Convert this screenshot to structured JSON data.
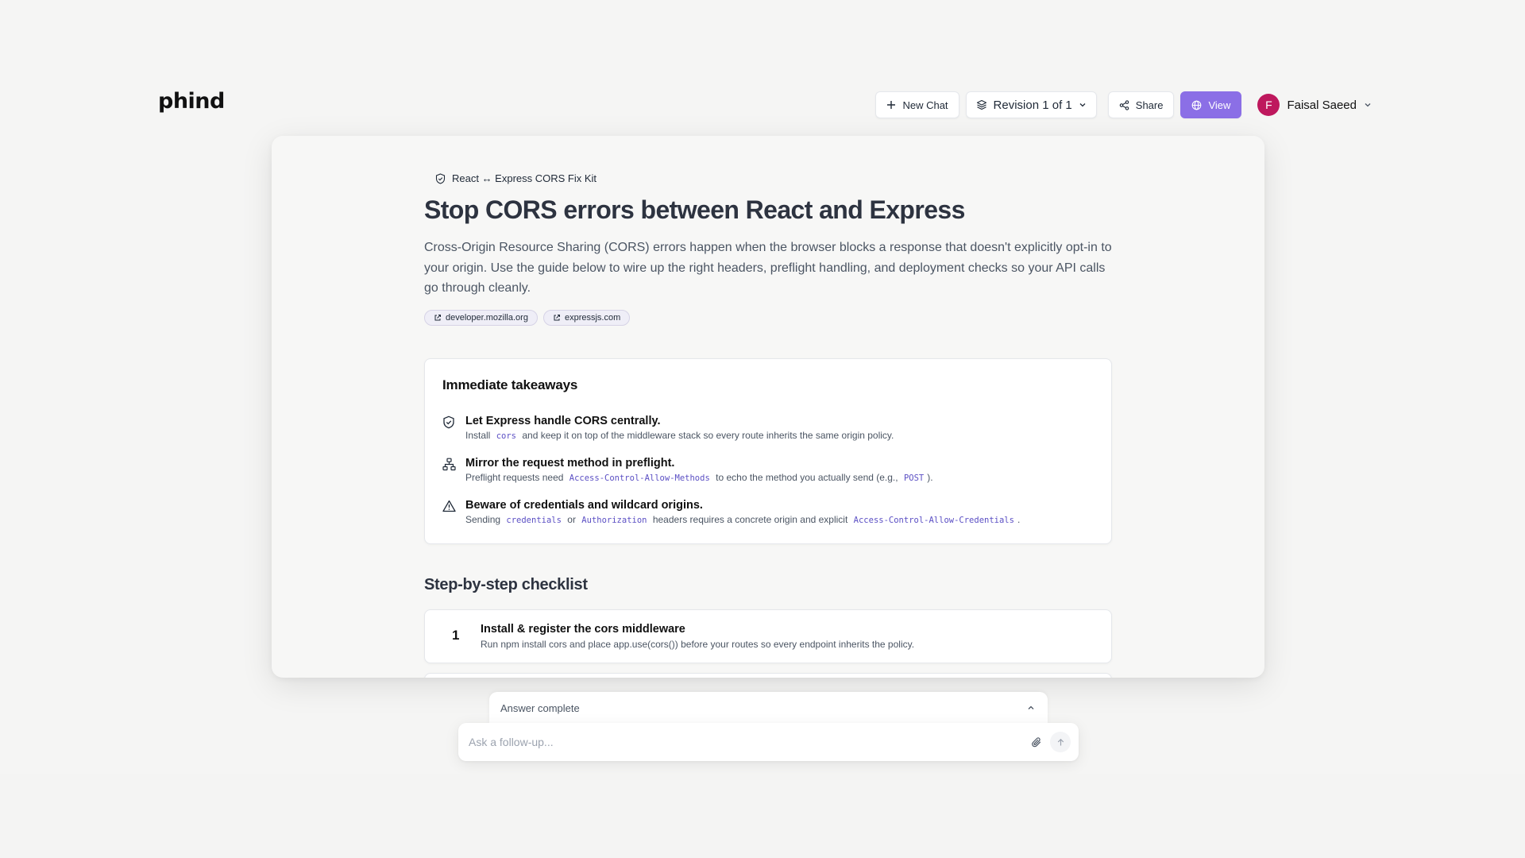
{
  "app": {
    "logo": "phind"
  },
  "header": {
    "new_chat": "New Chat",
    "revision": "Revision 1 of 1",
    "share": "Share",
    "view": "View",
    "user": {
      "initial": "F",
      "name": "Faisal Saeed",
      "avatar_color": "#be185d"
    }
  },
  "doc": {
    "kit_label": "React ↔ Express CORS Fix Kit",
    "title": "Stop CORS errors between React and Express",
    "intro": "Cross-Origin Resource Sharing (CORS) errors happen when the browser blocks a response that doesn't explicitly opt-in to your origin. Use the guide below to wire up the right headers, preflight handling, and deployment checks so your API calls go through cleanly.",
    "sources": [
      "developer.mozilla.org",
      "expressjs.com"
    ]
  },
  "takeaways": {
    "title": "Immediate takeaways",
    "items": [
      {
        "icon": "shield-check-icon",
        "title": "Let Express handle CORS centrally.",
        "parts": [
          "Install",
          "cors",
          "and keep it on top of the middleware stack so every route inherits the same origin policy."
        ]
      },
      {
        "icon": "network-icon",
        "title": "Mirror the request method in preflight.",
        "parts": [
          "Preflight requests need",
          "Access-Control-Allow-Methods",
          "to echo the method you actually send (e.g.,",
          "POST",
          ")."
        ]
      },
      {
        "icon": "warning-icon",
        "title": "Beware of credentials and wildcard origins.",
        "parts": [
          "Sending",
          "credentials",
          "or",
          "Authorization",
          "headers requires a concrete origin and explicit",
          "Access-Control-Allow-Credentials",
          "."
        ]
      }
    ]
  },
  "checklist": {
    "title": "Step-by-step checklist",
    "steps": [
      {
        "number": "1",
        "title": "Install & register the cors middleware",
        "desc": "Run npm install cors and place app.use(cors()) before your routes so every endpoint inherits the policy."
      }
    ]
  },
  "composer": {
    "status": "Answer complete",
    "placeholder": "Ask a follow-up..."
  },
  "colors": {
    "accent": "#8b6fe6",
    "code": "#5b4fc4"
  }
}
